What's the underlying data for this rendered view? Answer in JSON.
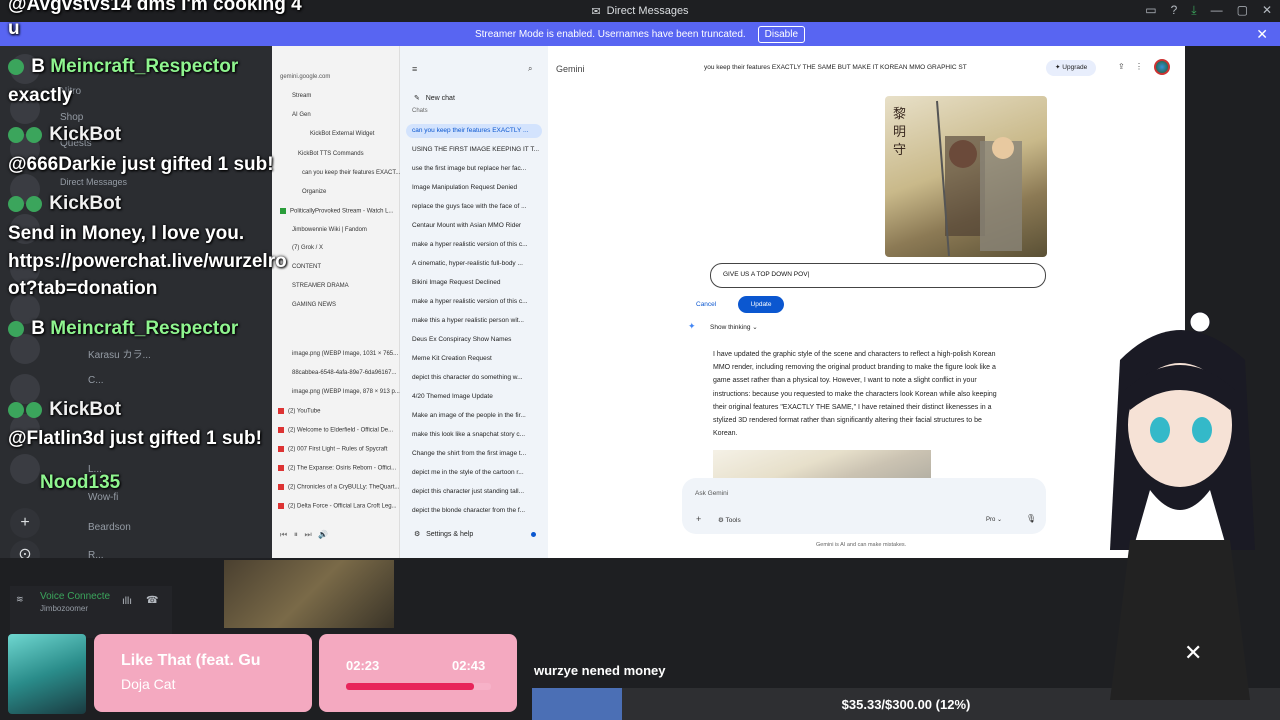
{
  "window": {
    "title": "Direct Messages"
  },
  "banner": {
    "text": "Streamer Mode is enabled. Usernames have been truncated.",
    "disable_label": "Disable"
  },
  "discord": {
    "nav": [
      "Nitro",
      "Shop",
      "Quests",
      "Direct Messages"
    ],
    "dms": [
      "Karasu カラ...",
      "C...",
      "L...",
      "Wow-fi",
      "Beardson",
      "R..."
    ],
    "voice": {
      "status": "Voice Connecte",
      "channel": "Jimbozoomer"
    }
  },
  "chat_overlay": [
    {
      "prefix": "B",
      "name": "Meincraft_Respector",
      "kind": "user"
    },
    {
      "text": "exactly"
    },
    {
      "name": "KickBot",
      "kind": "bot"
    },
    {
      "text": "@666Darkie just gifted 1 sub!"
    },
    {
      "name": "KickBot",
      "kind": "bot"
    },
    {
      "text": "Send in Money, I love you."
    },
    {
      "text": "https://powerchat.live/wurzelro"
    },
    {
      "text": "ot?tab=donation"
    },
    {
      "prefix": "B",
      "name": "Meincraft_Respector",
      "kind": "user"
    },
    {
      "name": "KickBot",
      "kind": "bot"
    },
    {
      "text": "@Flatlin3d just gifted 1 sub!"
    },
    {
      "name": "Nood135",
      "kind": "user"
    }
  ],
  "top_chat_fragment": "@Avgvstvs14 dms I'm cooking 4",
  "top_chat_fragment2": "u",
  "browser": {
    "address": "gemini.google.com",
    "bookmarks": {
      "folders": [
        "Stream",
        "AI Gen",
        "KickBot External Widget",
        "KickBot TTS Commands",
        "can you keep their features EXACT...",
        "Organize",
        "PoliticallyProvoked Stream - Watch L...",
        "Jimbowennie Wiki | Fandom",
        "(7) Grok / X",
        "CONTENT",
        "STREAMER DRAMA",
        "GAMING NEWS"
      ],
      "tabs": [
        "image.png (WEBP Image, 1031 × 765...",
        "88cabbea-6548-4afa-89e7-6da96167...",
        "image.png (WEBP Image, 878 × 913 p...",
        "(2) YouTube",
        "(2) Welcome to Elderfield - Official De...",
        "(2) 007 First Light – Rules of Spycraft",
        "(2) The Expanse: Osiris Reborn - Offici...",
        "(2) Chronicles of a CryBULLy: TheQuart...",
        "(2) Delta Force - Official Lara Croft Leg..."
      ]
    }
  },
  "gemini": {
    "brand": "Gemini",
    "conversation_title": "you keep their features EXACTLY THE SAME BUT MAKE IT KOREAN MMO GRAPHIC ST",
    "upgrade_label": "Upgrade",
    "new_chat": "New chat",
    "chats_header": "Chats",
    "chats": [
      "can you keep their features EXACTLY ...",
      "USING THE FIRST IMAGE KEEPING IT T...",
      "use the first image but replace her fac...",
      "Image Manipulation Request Denied",
      "replace the guys face with the face of ...",
      "Centaur Mount with Asian MMO Rider",
      "make a hyper realistic version of this c...",
      "A cinematic, hyper-realistic full-body ...",
      "Bikini Image Request Declined",
      "make a hyper realistic version of this c...",
      "make this a hyper realistic person wit...",
      "Deus Ex Conspiracy Show Names",
      "Meme Kit Creation Request",
      "depict this character do something w...",
      "4/20 Themed Image Update",
      "Make an image of the people in the fir...",
      "make this look like a snapchat story c...",
      "Change the shirt from the first image t...",
      "depict me in the style of the cartoon r...",
      "depict this character just standing tall...",
      "depict the blonde character from the f..."
    ],
    "settings_label": "Settings & help",
    "edit_prompt_value": "GIVE US A TOP DOWN POV",
    "cancel_label": "Cancel",
    "update_label": "Update",
    "show_thinking": "Show thinking",
    "response_lines": [
      "I have updated the graphic style of the scene and characters to reflect a high-polish Korean",
      "MMO render, including removing the original product branding to make the figure look like a",
      "game asset rather than a physical toy. However, I want to note a slight conflict in your",
      "instructions: because you requested to make the characters look Korean while also keeping",
      "their original features \"EXACTLY THE SAME,\" I have retained their distinct likenesses in a",
      "stylized 3D rendered format rather than significantly altering their facial structures to be",
      "Korean."
    ],
    "ask_placeholder": "Ask Gemini",
    "tools_label": "Tools",
    "model_label": "Pro",
    "disclaimer": "Gemini is AI and can make mistakes."
  },
  "music": {
    "title": "Like That (feat. Gu",
    "artist": "Doja Cat",
    "elapsed": "02:23",
    "total": "02:43",
    "progress": 0.88
  },
  "ticker": {
    "text": "wurzye nened money"
  },
  "donation": {
    "text": "$35.33/$300.00 (12%)",
    "progress": 0.12
  },
  "colors": {
    "discord_blurple": "#5865f2",
    "gemini_blue": "#0b57d0",
    "music_pink": "#f4a9c0",
    "progress_red": "#e8245a"
  }
}
